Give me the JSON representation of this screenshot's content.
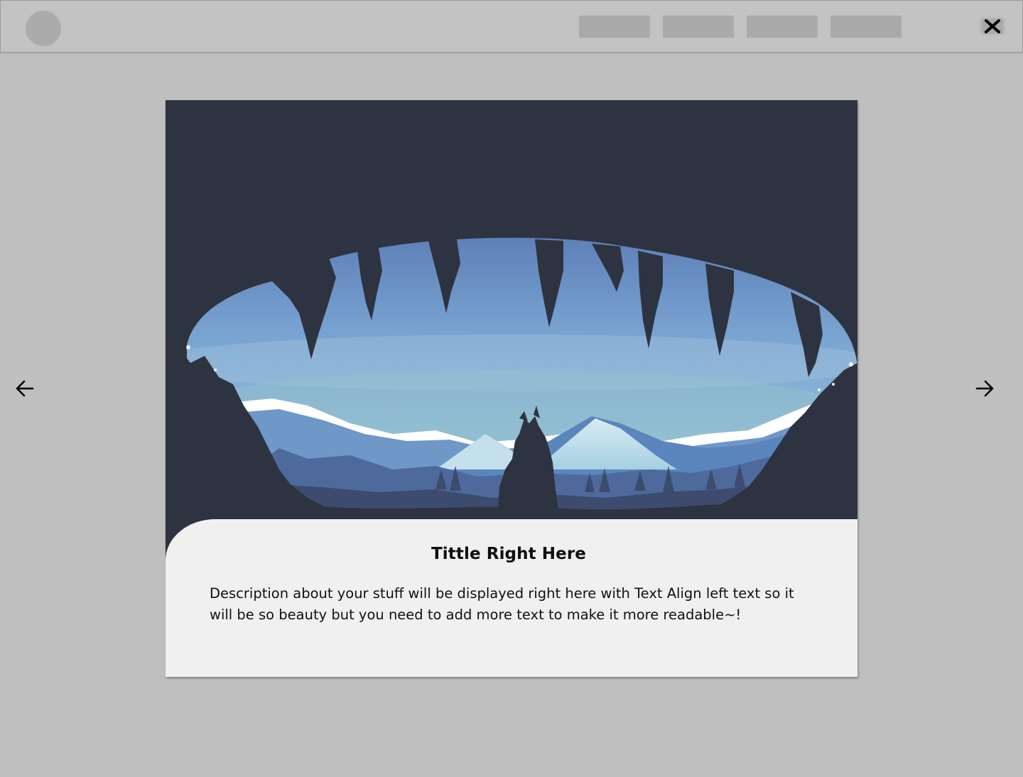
{
  "modal": {
    "title": "Tittle Right Here",
    "description": "Description about your stuff will be displayed right here with Text Align left text so it will be so beauty but you need to add more text to make it more readable~!"
  },
  "controls": {
    "close_label": "X",
    "prev_icon": "arrow-left-icon",
    "next_icon": "arrow-right-icon"
  },
  "colors": {
    "backdrop": "#bfbfbf",
    "image_background": "#2e3341",
    "card_body": "#f0f0f0"
  }
}
